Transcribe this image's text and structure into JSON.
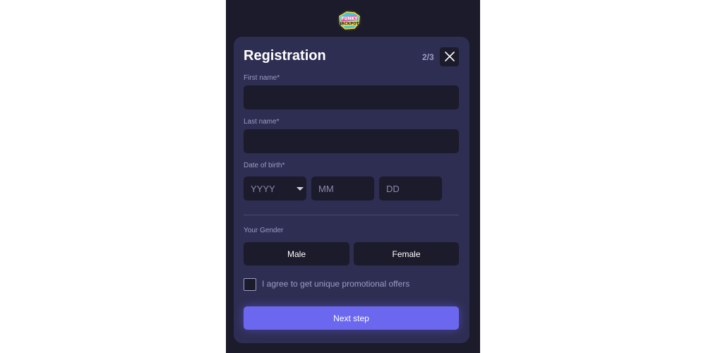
{
  "brand": {
    "logo_text": "FUNKY JACKPOT"
  },
  "registration": {
    "title": "Registration",
    "step": "2/3",
    "first_name": {
      "label": "First name*",
      "value": "",
      "placeholder": ""
    },
    "last_name": {
      "label": "Last name*",
      "value": "",
      "placeholder": ""
    },
    "dob": {
      "label": "Date of birth*",
      "year_placeholder": "YYYY",
      "month_placeholder": "MM",
      "day_placeholder": "DD"
    },
    "gender": {
      "label": "Your Gender",
      "options": [
        "Male",
        "Female"
      ]
    },
    "promo_checkbox": {
      "label": "I agree to get unique promotional offers",
      "checked": false
    },
    "next_button": "Next step"
  },
  "colors": {
    "page_bg": "#1c1b2b",
    "modal_bg": "#2e2d52",
    "field_bg": "#1c1b2b",
    "label_text": "#9d9cc6",
    "accent": "#6b68ef"
  },
  "icons": {
    "close": "close-icon",
    "dropdown": "chevron-down-icon"
  }
}
